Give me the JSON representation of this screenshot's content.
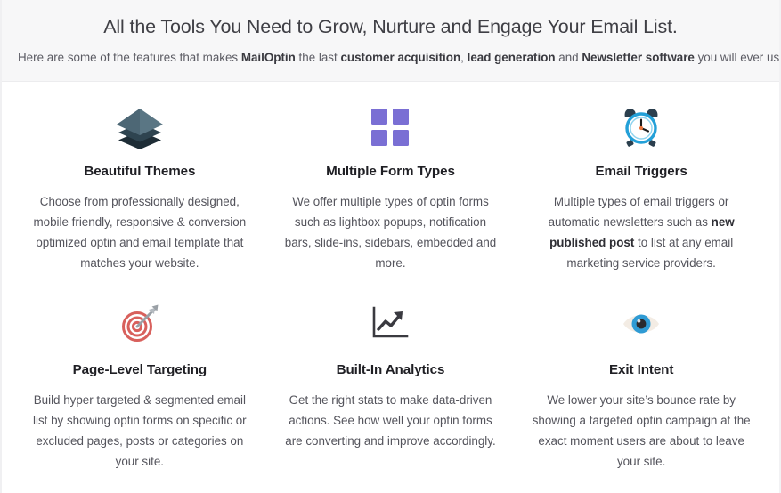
{
  "header": {
    "title": "All the Tools You Need to Grow, Nurture and Engage Your Email List.",
    "subtitle_parts": [
      {
        "text": "Here are some of the features that makes ",
        "bold": false
      },
      {
        "text": "MailOptin",
        "bold": true
      },
      {
        "text": " the last ",
        "bold": false
      },
      {
        "text": "customer acquisition",
        "bold": true
      },
      {
        "text": ", ",
        "bold": false
      },
      {
        "text": "lead generation",
        "bold": true
      },
      {
        "text": " and ",
        "bold": false
      },
      {
        "text": "Newsletter software",
        "bold": true
      },
      {
        "text": " you will ever use.",
        "bold": false
      }
    ],
    "background_color": "#f7f7f8"
  },
  "features": [
    {
      "icon": "layers-icon",
      "title": "Beautiful Themes",
      "desc_parts": [
        {
          "text": "Choose from professionally designed, mobile friendly, responsive & conversion optimized optin and email template that matches your website.",
          "bold": false
        }
      ],
      "icon_colors": {
        "top": "#5a7684",
        "mid": "#2e4450",
        "bottom": "#1e2d36"
      }
    },
    {
      "icon": "grid-squares-icon",
      "title": "Multiple Form Types",
      "desc_parts": [
        {
          "text": "We offer multiple types of optin forms such as lightbox popups, notification bars, slide-ins, sidebars, embedded and more.",
          "bold": false
        }
      ],
      "icon_colors": {
        "fill": "#7a6fd4"
      }
    },
    {
      "icon": "alarm-clock-icon",
      "title": "Email Triggers",
      "desc_parts": [
        {
          "text": "Multiple types of email triggers or automatic newsletters such as ",
          "bold": false
        },
        {
          "text": "new published post",
          "bold": true
        },
        {
          "text": " to list at any email marketing service providers.",
          "bold": false
        }
      ],
      "icon_colors": {
        "ring": "#23a0d8",
        "bell": "#2b3f4e",
        "hand": "#1b1b1b",
        "center": "#e8743b"
      }
    },
    {
      "icon": "target-arrow-icon",
      "title": "Page-Level Targeting",
      "desc_parts": [
        {
          "text": "Build hyper targeted & segmented email list by showing optin forms on specific or excluded pages, posts or categories on your site.",
          "bold": false
        }
      ],
      "icon_colors": {
        "ring": "#d8605c",
        "arrow": "#9aa0a6"
      }
    },
    {
      "icon": "analytics-chart-icon",
      "title": "Built-In Analytics",
      "desc_parts": [
        {
          "text": "Get the right stats to make data-driven actions. See how well your optin forms are converting and improve accordingly.",
          "bold": false
        }
      ],
      "icon_colors": {
        "stroke": "#3a3a40"
      }
    },
    {
      "icon": "eye-icon",
      "title": "Exit Intent",
      "desc_parts": [
        {
          "text": "We lower your site’s bounce rate by showing a targeted optin campaign at the exact moment users are about to leave your site.",
          "bold": false
        }
      ],
      "icon_colors": {
        "sclera": "#f3ece4",
        "iris": "#2f9bd4",
        "pupil": "#2a2a2e"
      }
    }
  ]
}
